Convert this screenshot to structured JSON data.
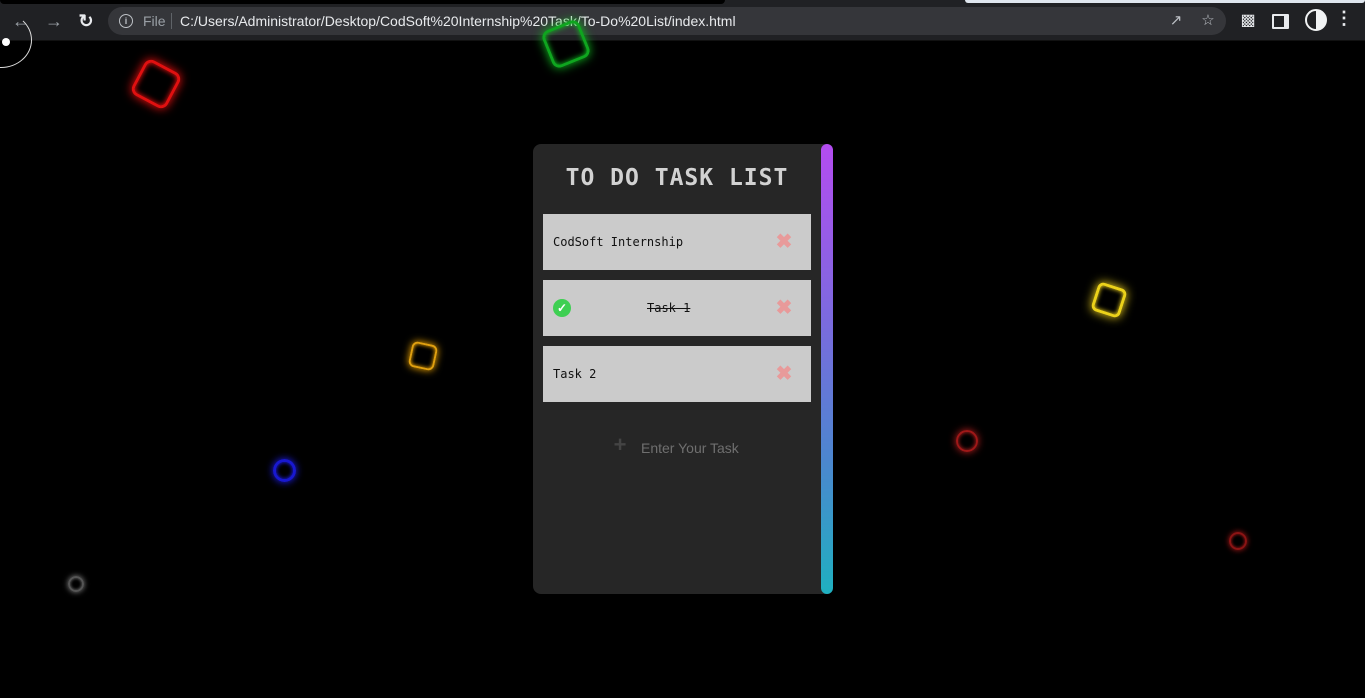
{
  "browser": {
    "file_label": "File",
    "url": "C:/Users/Administrator/Desktop/CodSoft%20Internship%20Task/To-Do%20List/index.html"
  },
  "app": {
    "title": "TO DO TASK LIST",
    "tasks": [
      {
        "text": "CodSoft Internship",
        "completed": false
      },
      {
        "text": "Task 1",
        "completed": true
      },
      {
        "text": "Task 2",
        "completed": false
      }
    ],
    "input_placeholder": "Enter Your Task",
    "add_icon": "plus-icon",
    "delete_icon": "close-icon",
    "complete_icon": "check-circle-icon"
  },
  "colors": {
    "background": "#000000",
    "card": "#262626",
    "task_item": "#cbcbcb",
    "delete": "#e89a9a",
    "complete": "#3ecf52",
    "scrollbar_top": "#b44cf0",
    "scrollbar_bottom": "#1fb0c0"
  }
}
